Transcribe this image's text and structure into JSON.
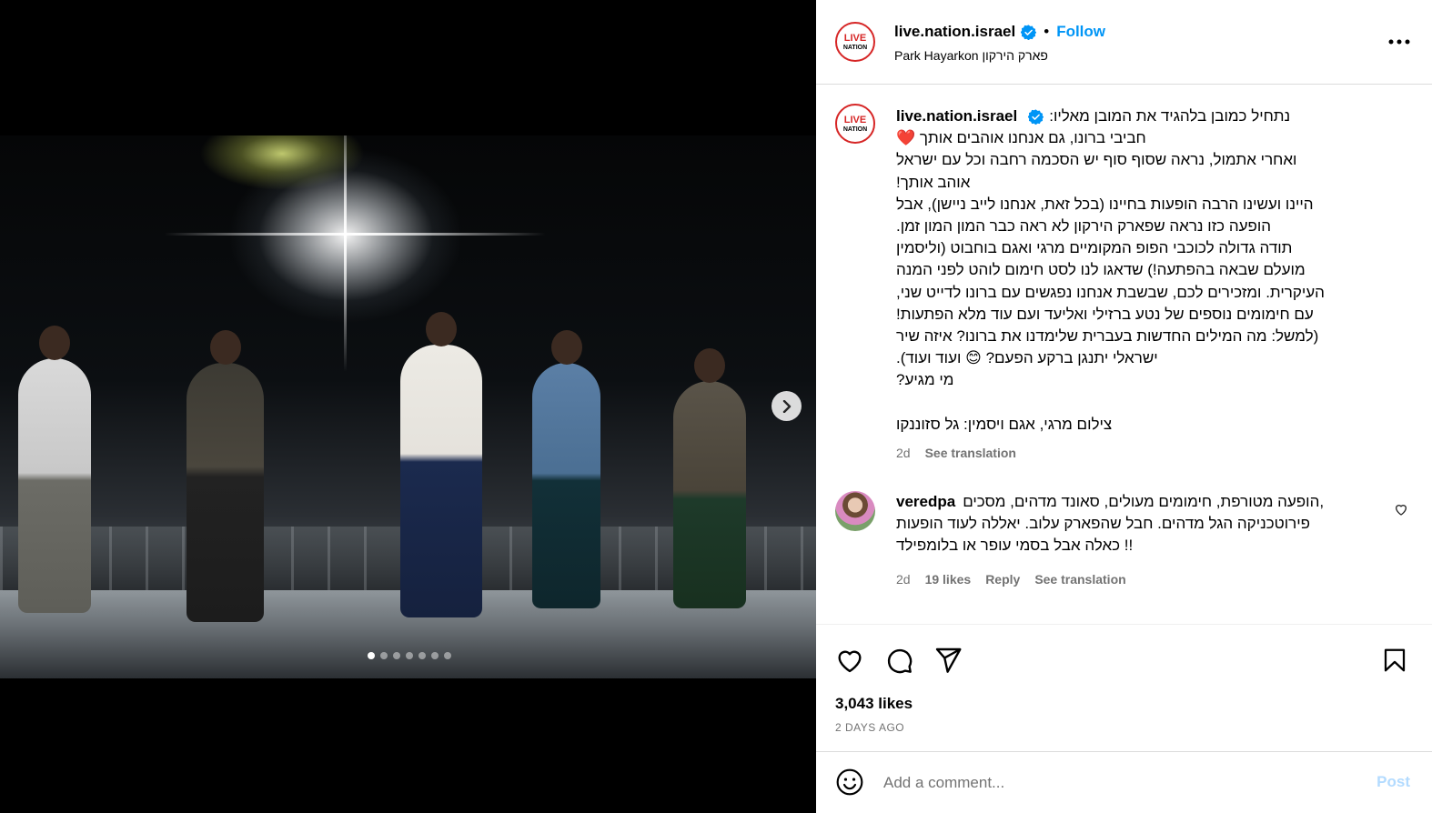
{
  "post": {
    "username": "live.nation.israel",
    "follow_label": "Follow",
    "separator": "•",
    "location": "Park Hayarkon פארק הירקון",
    "avatar_line1": "LIVE",
    "avatar_line2": "NATION",
    "brand_color": "#d62626"
  },
  "caption": {
    "lines": [
      "נתחיל כמובן בלהגיד את המובן מאליו:",
      "חביבי ברונו, גם אנחנו אוהבים אותך ❤️",
      "ואחרי אתמול, נראה שסוף סוף יש הסכמה רחבה וכל עם ישראל",
      "אוהב אותך!",
      "היינו ועשינו הרבה הופעות בחיינו (בכל זאת, אנחנו לייב ניישן), אבל",
      "הופעה כזו נראה שפארק הירקון לא ראה כבר המון המון זמן.",
      "תודה גדולה לכוכבי הפופ המקומיים מרגי ואגם בוחבוט (וליסמין",
      "מועלם שבאה בהפתעה!) שדאגו לנו לסט חימום לוהט לפני המנה",
      "העיקרית. ומזכירים לכם, שבשבת אנחנו נפגשים עם ברונו לדייט שני,",
      "עם חימומים נוספים של נטע ברזילי ואליעד ועם עוד מלא הפתעות!",
      "(למשל: מה המילים החדשות בעברית שלימדנו את ברונו? איזה שיר",
      "ישראלי יתנגן ברקע הפעם? 😊 ועוד ועוד).",
      "מי מגיע?",
      "",
      "צילום מרגי, אגם ויסמין: גל סזוננקו"
    ],
    "time": "2d",
    "see_translation": "See translation"
  },
  "comment": {
    "username": "veredpa",
    "lines": [
      "הופעה מטורפת, חימומים מעולים, סאונד מדהים, מסכים,",
      "פירוטכניקה הגל מדהים. חבל שהפארק עלוב. יאללה לעוד הופעות",
      "כאלה אבל בסמי עופר או בלומפילד !!"
    ],
    "time": "2d",
    "likes": "19 likes",
    "reply": "Reply",
    "see_translation": "See translation"
  },
  "actions": {
    "likes": "3,043 likes",
    "date": "2 DAYS AGO"
  },
  "add_comment": {
    "placeholder": "Add a comment...",
    "post_label": "Post"
  },
  "carousel": {
    "total": 7,
    "active_index": 0
  },
  "colors": {
    "link_blue": "#0095f6",
    "post_disabled": "#b3dbff",
    "muted": "#737373"
  }
}
